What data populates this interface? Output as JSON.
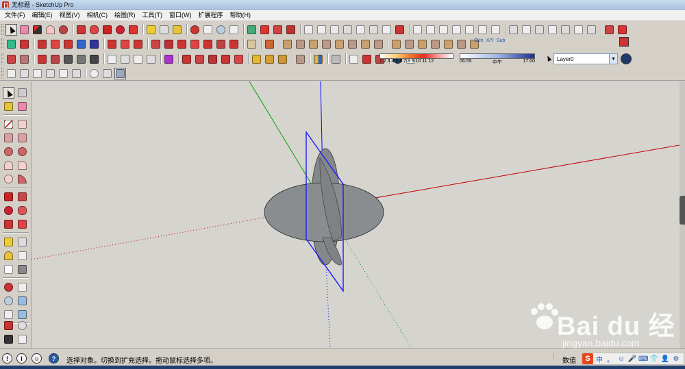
{
  "window": {
    "title": "无标题 - SketchUp Pro"
  },
  "menu": [
    "文件(F)",
    "编辑(E)",
    "视图(V)",
    "相机(C)",
    "绘图(R)",
    "工具(T)",
    "窗口(W)",
    "扩展程序",
    "帮助(H)"
  ],
  "toolbar": {
    "shadow_months": "1 2 3 4 5 6 7 8 9 10 11 12",
    "shadow_time_start": "06:55",
    "shadow_time_mid": "中午",
    "shadow_time_end": "17:00",
    "layer_selected": "Layer0",
    "sandbox_labels": [
      "Skin",
      "X/Y",
      "Sub"
    ]
  },
  "statusbar": {
    "hint": "选择对象。切换到扩充选择。拖动鼠标选择多项。",
    "measurements_label": "数值",
    "ime": [
      "中",
      "。",
      "☺",
      "🎤",
      "⌨",
      "👕",
      "👤",
      "⚙"
    ]
  },
  "watermark": {
    "logo_text": "Bai du 经验",
    "url": "jingyan.baidu.com"
  },
  "colors": {
    "viewport_bg": "#d6d4cf",
    "disk_fill": "#8a8d90",
    "plane_outline": "#1a1aff",
    "axis_red": "#c00000",
    "axis_green": "#00a000",
    "axis_blue": "#0000ff"
  },
  "icons": {
    "select": "select-arrow-icon",
    "eraser": "eraser-icon",
    "pencil": "pencil-icon",
    "orbit": "orbit-icon",
    "zoom": "zoom-icon"
  }
}
